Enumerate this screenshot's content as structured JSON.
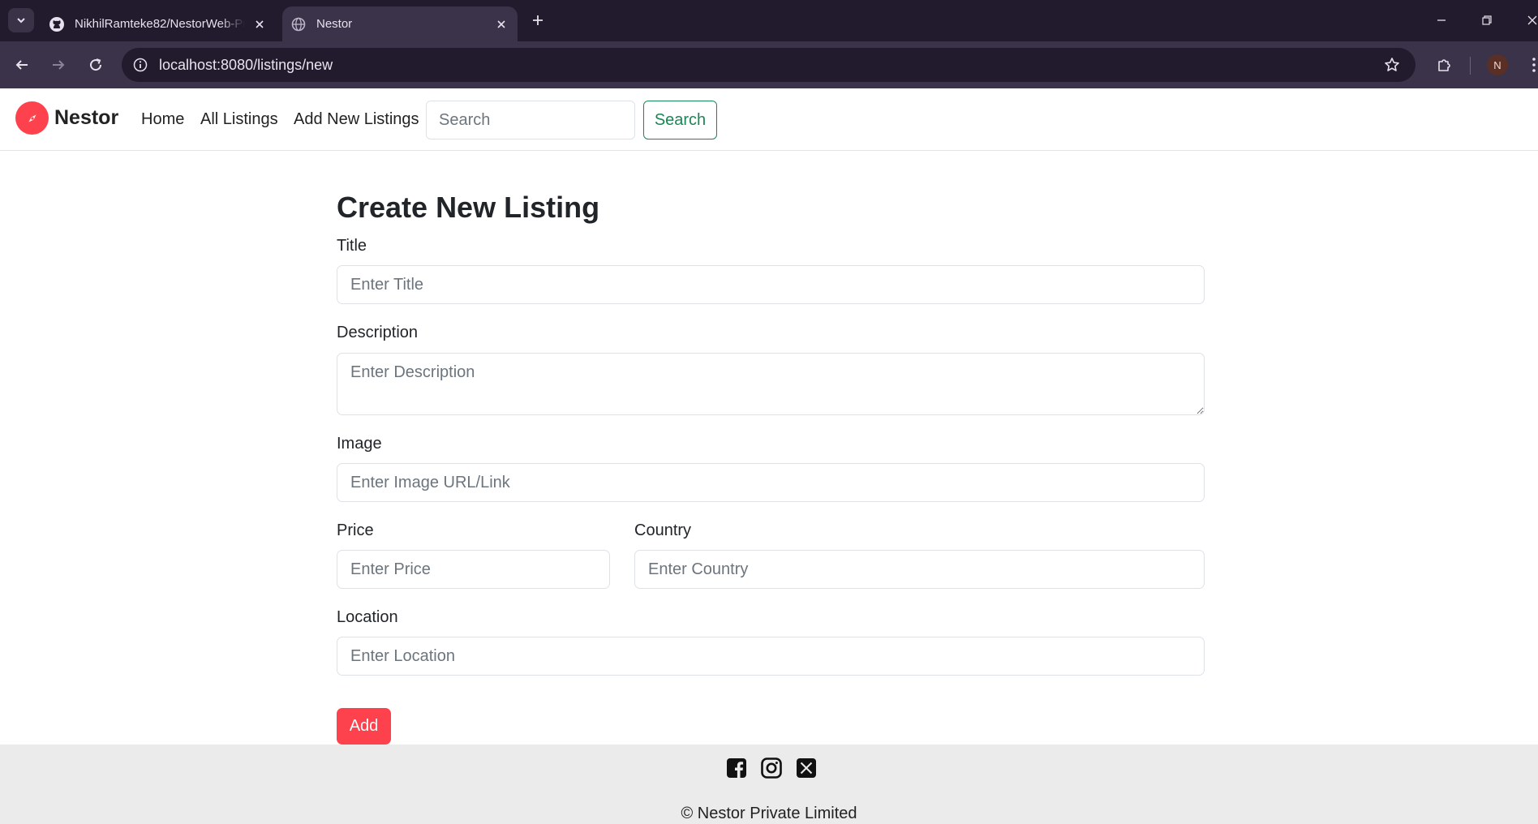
{
  "browser": {
    "tabs": [
      {
        "title": "NikhilRamteke82/NestorWeb-Project",
        "icon": "github-icon",
        "active": false
      },
      {
        "title": "Nestor",
        "icon": "globe-icon",
        "active": true
      }
    ],
    "url": "localhost:8080/listings/new",
    "profile_initial": "N"
  },
  "navbar": {
    "brand": "Nestor",
    "links": [
      "Home",
      "All Listings",
      "Add New Listings"
    ],
    "search_placeholder": "Search",
    "search_button": "Search"
  },
  "form": {
    "heading": "Create New Listing",
    "title_label": "Title",
    "title_placeholder": "Enter Title",
    "description_label": "Description",
    "description_placeholder": "Enter Description",
    "image_label": "Image",
    "image_placeholder": "Enter Image URL/Link",
    "price_label": "Price",
    "price_placeholder": "Enter Price",
    "country_label": "Country",
    "country_placeholder": "Enter Country",
    "location_label": "Location",
    "location_placeholder": "Enter Location",
    "submit_label": "Add"
  },
  "footer": {
    "social": [
      "facebook-icon",
      "instagram-icon",
      "x-icon"
    ],
    "copyright": "© Nestor Private Limited"
  },
  "colors": {
    "accent": "#fe424d",
    "success": "#198754",
    "footer_bg": "#ebebeb"
  }
}
